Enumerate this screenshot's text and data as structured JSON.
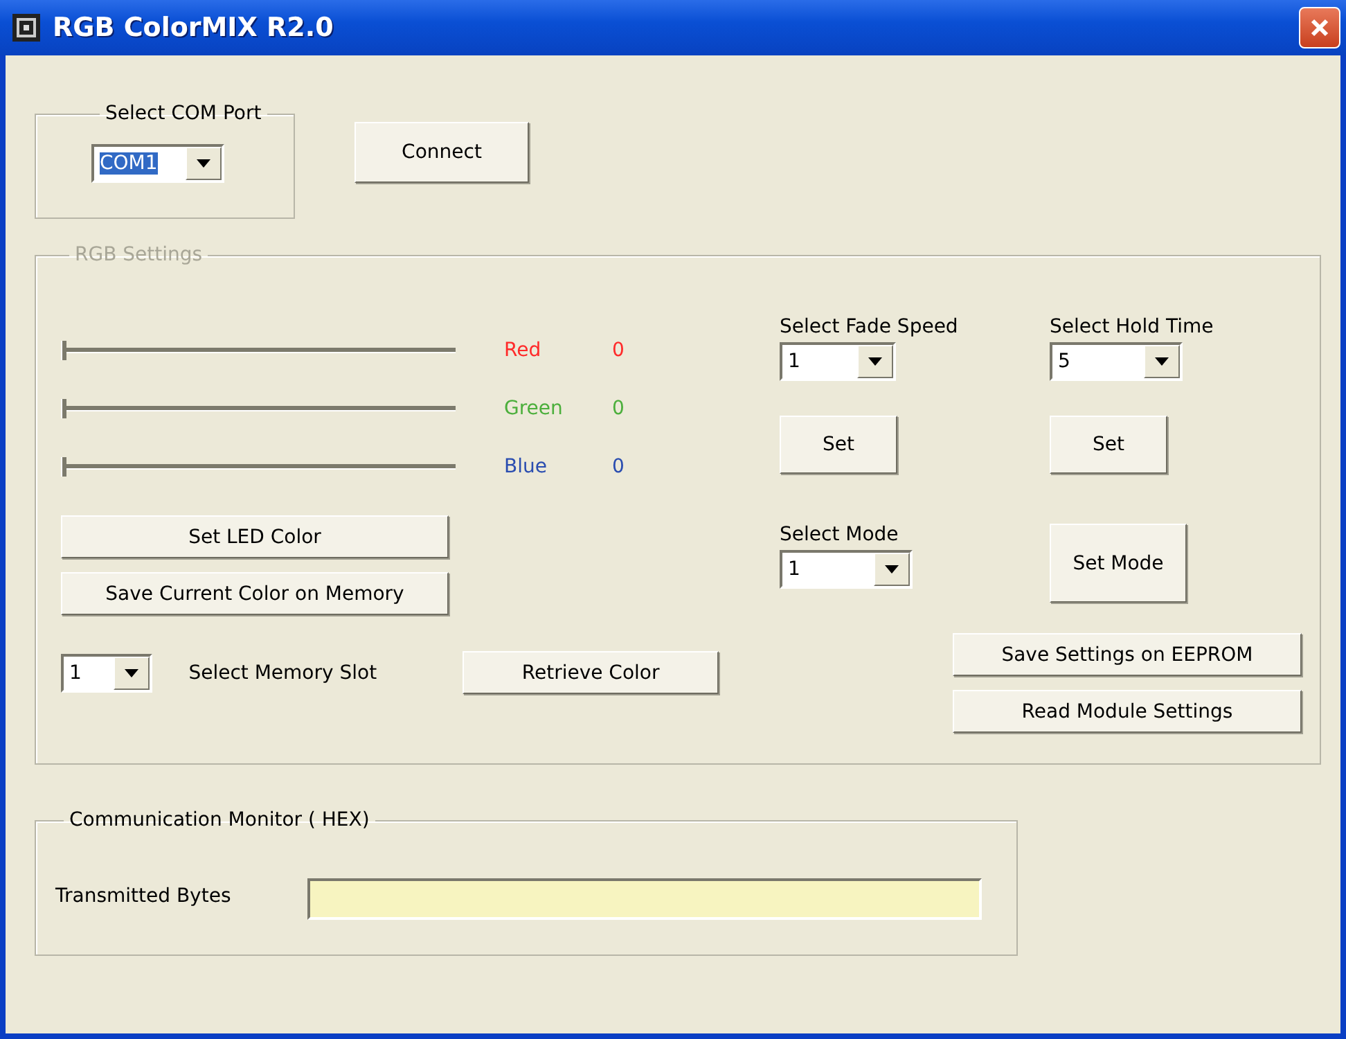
{
  "window": {
    "title": "RGB ColorMIX R2.0"
  },
  "com_port": {
    "title": "Select COM Port",
    "disabled": false,
    "combo": {
      "value": "COM1",
      "text_selected": true
    },
    "connect_button": "Connect"
  },
  "rgb_settings": {
    "title": "RGB Settings",
    "disabled": true,
    "channels": [
      {
        "name": "Red",
        "value": "0",
        "level": 0,
        "color": "#ff2a2a"
      },
      {
        "name": "Green",
        "value": "0",
        "level": 0,
        "color": "#4caf3c"
      },
      {
        "name": "Blue",
        "value": "0",
        "level": 0,
        "color": "#2a4db0"
      }
    ],
    "set_led_button": "Set LED Color",
    "save_color_button": "Save Current Color on Memory",
    "memory_slot": {
      "combo": {
        "value": "1",
        "text_selected": false
      },
      "label": "Select Memory Slot"
    },
    "retrieve_button": "Retrieve Color",
    "fade_speed": {
      "label": "Select Fade Speed",
      "combo": {
        "value": "1",
        "text_selected": false
      },
      "button": "Set"
    },
    "hold_time": {
      "label": "Select Hold Time",
      "combo": {
        "value": "5",
        "text_selected": false
      },
      "button": "Set"
    },
    "mode": {
      "label": "Select Mode",
      "combo": {
        "value": "1",
        "text_selected": false
      },
      "button": "Set Mode"
    },
    "save_eeprom_button": "Save Settings on EEPROM",
    "read_settings_button": "Read Module Settings"
  },
  "monitor": {
    "title": "Communication Monitor ( HEX)",
    "disabled": false,
    "label": "Transmitted Bytes"
  }
}
